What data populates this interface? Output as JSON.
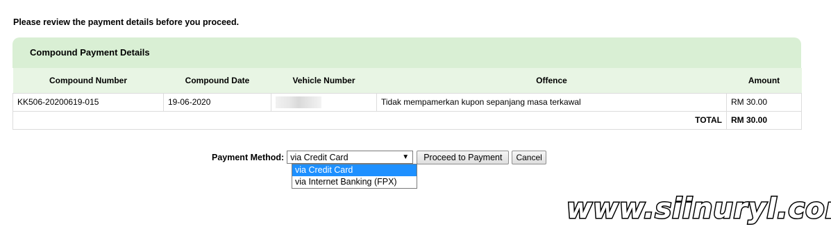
{
  "intro_text": "Please review the payment details before you proceed.",
  "panel": {
    "title": "Compound Payment Details",
    "columns": [
      "Compound Number",
      "Compound Date",
      "Vehicle Number",
      "Offence",
      "Amount"
    ],
    "rows": [
      {
        "compound_number": "KK506-20200619-015",
        "compound_date": "19-06-2020",
        "vehicle_number": "",
        "offence": "Tidak mempamerkan kupon sepanjang masa terkawal",
        "amount": "RM 30.00"
      }
    ],
    "total_label": "TOTAL",
    "total_amount": "RM 30.00"
  },
  "payment": {
    "label": "Payment Method:",
    "selected": "via Credit Card",
    "options": [
      "via Credit Card",
      "via Internet Banking (FPX)"
    ],
    "proceed_label": "Proceed to Payment",
    "cancel_label": "Cancel"
  },
  "watermark": "www.siinuryl.com",
  "colors": {
    "panel_header": "#d9efd4",
    "table_header": "#e8f5e4",
    "selected_option": "#1e90ff"
  }
}
